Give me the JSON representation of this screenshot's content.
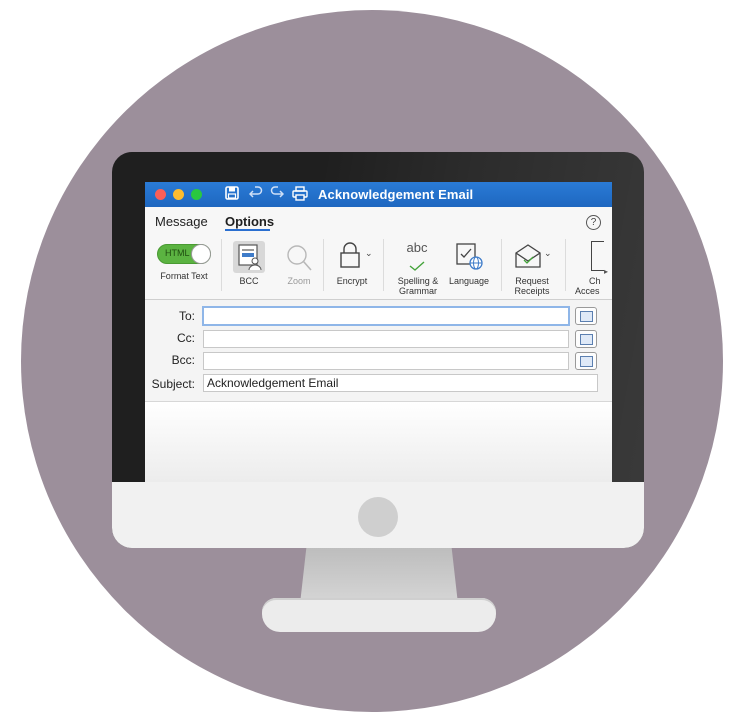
{
  "window": {
    "title": "Acknowledgement Email",
    "icons": [
      "save-icon",
      "undo-icon",
      "redo-icon",
      "print-icon"
    ]
  },
  "tabs": {
    "message": "Message",
    "options": "Options",
    "help": "?"
  },
  "ribbon": {
    "format_toggle": "HTML",
    "format_label": "Format Text",
    "bcc_label": "BCC",
    "zoom_label": "Zoom",
    "encrypt_label": "Encrypt",
    "spelling_icon_text": "abc",
    "spelling_label_1": "Spelling &",
    "spelling_label_2": "Grammar",
    "language_label": "Language",
    "receipts_label_1": "Request",
    "receipts_label_2": "Receipts",
    "access_label_1": "Ch",
    "access_label_2": "Acces"
  },
  "fields": {
    "to_label": "To:",
    "to_value": "",
    "cc_label": "Cc:",
    "cc_value": "",
    "bcc_label": "Bcc:",
    "bcc_value": "",
    "subject_label": "Subject:",
    "subject_value": "Acknowledgement Email"
  },
  "colors": {
    "background_circle": "#9c8f9b",
    "titlebar": "#1e67c0",
    "toggle_on": "#5bb341"
  }
}
